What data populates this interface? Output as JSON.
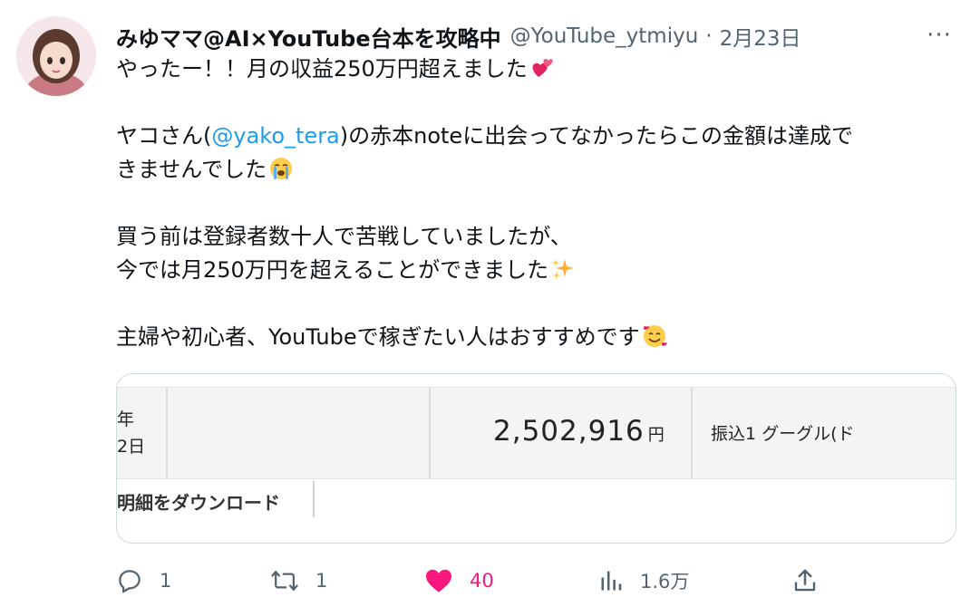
{
  "tweet": {
    "author_name": "みゆママ@AI×YouTube台本を攻略中",
    "handle": "@YouTube_ytmiyu",
    "separator": "·",
    "date": "2月23日",
    "more_label": "···",
    "text": {
      "line1": "やったー！！月の収益250万円超えました",
      "line2_prefix": "ヤコさん(",
      "mention": "@yako_tera",
      "line2_suffix": ")の赤本noteに出会ってなかったらこの金額は達成で",
      "line3": "きませんでした",
      "line4": "買う前は登録者数十人で苦戦していましたが、",
      "line5": "今では月250万円を超えることができました",
      "line6": "主婦や初心者、YouTubeで稼ぎたい人はおすすめです"
    },
    "emojis": {
      "line1": "two-hearts-emoji",
      "line3": "loudly-crying-emoji",
      "line5": "sparkles-emoji",
      "line6": "smiling-face-with-hearts-emoji"
    }
  },
  "media": {
    "year_fragment": "年",
    "day_fragment": "2日",
    "amount": "2,502,916",
    "amount_unit": "円",
    "description": "振込1 グーグル(ド",
    "download_label": "明細をダウンロード"
  },
  "actions": {
    "reply_count": "1",
    "retweet_count": "1",
    "like_count": "40",
    "views_count": "1.6万"
  },
  "colors": {
    "accent": "#1d9bf0",
    "like": "#f91880",
    "secondary_text": "#536471"
  }
}
